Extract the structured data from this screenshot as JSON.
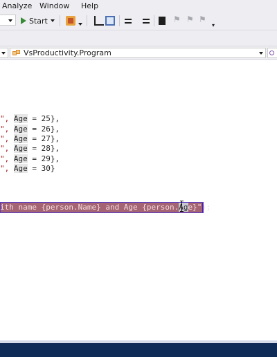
{
  "menubar": {
    "items": [
      "Analyze",
      "Window",
      "Help"
    ]
  },
  "toolbar": {
    "start_label": "Start",
    "icons": [
      "hot-reload-icon",
      "step-into-icon",
      "step-over-icon",
      "comment-icon",
      "uncomment-icon",
      "bookmark-icon",
      "previous-bookmark-icon",
      "next-bookmark-icon",
      "clear-bookmarks-icon"
    ]
  },
  "navbar": {
    "class_combo": "VsProductivity.Program"
  },
  "editor": {
    "lines": [
      {
        "quote": "\",",
        "sep": " ",
        "prop": "Age",
        "rest": " = 25},"
      },
      {
        "quote": "\",",
        "sep": " ",
        "prop": "Age",
        "rest": " = 26},"
      },
      {
        "quote": "\",",
        "sep": " ",
        "prop": "Age",
        "rest": " = 27},"
      },
      {
        "quote": "\",",
        "sep": " ",
        "prop": "Age",
        "rest": " = 28},"
      },
      {
        "quote": "\",",
        "sep": " ",
        "prop": "Age",
        "rest": " = 29},"
      },
      {
        "quote": "\",",
        "sep": " ",
        "prop": "Age",
        "rest": " = 30}"
      }
    ],
    "selected_line": {
      "part1": "ith name {person.Name} and Age {person.",
      "part2": "Ag",
      "part3": "e}\");"
    }
  },
  "colors": {
    "menubar_bg": "#eeeef2",
    "statusbar_bg": "#0e2a56",
    "selection_bg": "#a46474",
    "selection_border": "#5b3bbf",
    "string_color": "#a31515"
  }
}
